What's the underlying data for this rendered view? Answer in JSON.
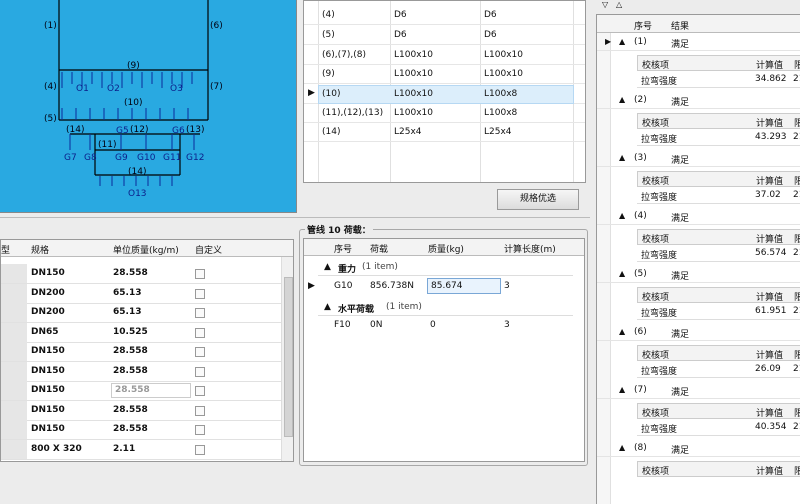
{
  "diagram": {
    "labels": [
      "(1)",
      "(6)",
      "(9)",
      "(4)",
      "(7)",
      "O1",
      "O2",
      "O3",
      "(10)",
      "(5)",
      "(14)",
      "(12)",
      "(13)",
      "G5",
      "G6",
      "G7",
      "G8",
      "G9",
      "G10",
      "G11",
      "G12",
      "(11)",
      "(14)",
      "O13"
    ]
  },
  "section_grid": {
    "rows": [
      {
        "name": "(4)",
        "sec1": "D6",
        "sec2": "D6"
      },
      {
        "name": "(5)",
        "sec1": "D6",
        "sec2": "D6"
      },
      {
        "name": "(6),(7),(8)",
        "sec1": "L100x10",
        "sec2": "L100x10"
      },
      {
        "name": "(9)",
        "sec1": "L100x10",
        "sec2": "L100x10"
      },
      {
        "name": "(10)",
        "sec1": "L100x10",
        "sec2": "L100x8"
      },
      {
        "name": "(11),(12),(13)",
        "sec1": "L100x10",
        "sec2": "L100x8"
      },
      {
        "name": "(14)",
        "sec1": "L25x4",
        "sec2": "L25x4"
      }
    ],
    "selected_marker": "▶"
  },
  "optimize_button": "规格优选",
  "spec_grid": {
    "headers": [
      "型",
      "规格",
      "单位质量(kg/m)",
      "自定义"
    ],
    "rows": [
      {
        "spec": "DN150",
        "mass": "28.558"
      },
      {
        "spec": "DN200",
        "mass": "65.13"
      },
      {
        "spec": "DN200",
        "mass": "65.13"
      },
      {
        "spec": "DN65",
        "mass": "10.525"
      },
      {
        "spec": "DN150",
        "mass": "28.558"
      },
      {
        "spec": "DN150",
        "mass": "28.558"
      },
      {
        "spec": "DN150",
        "mass": "28.558"
      },
      {
        "spec": "DN150",
        "mass": "28.558"
      },
      {
        "spec": "DN150",
        "mass": "28.558"
      },
      {
        "spec": "800 X 320",
        "mass": "2.11"
      }
    ]
  },
  "load_panel": {
    "title": "管线 10 荷载：",
    "headers": [
      "序号",
      "荷载",
      "质量(kg)",
      "计算长度(m)"
    ],
    "groups": [
      {
        "name": "重力",
        "count": "(1 item)",
        "rows": [
          {
            "id": "G10",
            "load": "856.738N",
            "mass": "85.674",
            "length": "3"
          }
        ]
      },
      {
        "name": "水平荷载",
        "count": "(1 item)",
        "rows": [
          {
            "id": "F10",
            "load": "0N",
            "mass": "0",
            "length": "3"
          }
        ]
      }
    ]
  },
  "results_panel": {
    "headers": [
      "序号",
      "结果"
    ],
    "sub_headers": [
      "校核项",
      "计算值",
      "限"
    ],
    "groups": [
      {
        "num": "(1)",
        "result": "满足",
        "item": "拉弯强度",
        "value": "34.862",
        "limit": "21"
      },
      {
        "num": "(2)",
        "result": "满足",
        "item": "拉弯强度",
        "value": "43.293",
        "limit": "21"
      },
      {
        "num": "(3)",
        "result": "满足",
        "item": "拉弯强度",
        "value": "37.02",
        "limit": "21"
      },
      {
        "num": "(4)",
        "result": "满足",
        "item": "拉弯强度",
        "value": "56.574",
        "limit": "21"
      },
      {
        "num": "(5)",
        "result": "满足",
        "item": "拉弯强度",
        "value": "61.951",
        "limit": "21"
      },
      {
        "num": "(6)",
        "result": "满足",
        "item": "拉弯强度",
        "value": "26.09",
        "limit": "21"
      },
      {
        "num": "(7)",
        "result": "满足",
        "item": "拉弯强度",
        "value": "40.354",
        "limit": "21"
      },
      {
        "num": "(8)",
        "result": "满足",
        "item": "计算值",
        "value": "",
        "limit": ""
      }
    ]
  }
}
